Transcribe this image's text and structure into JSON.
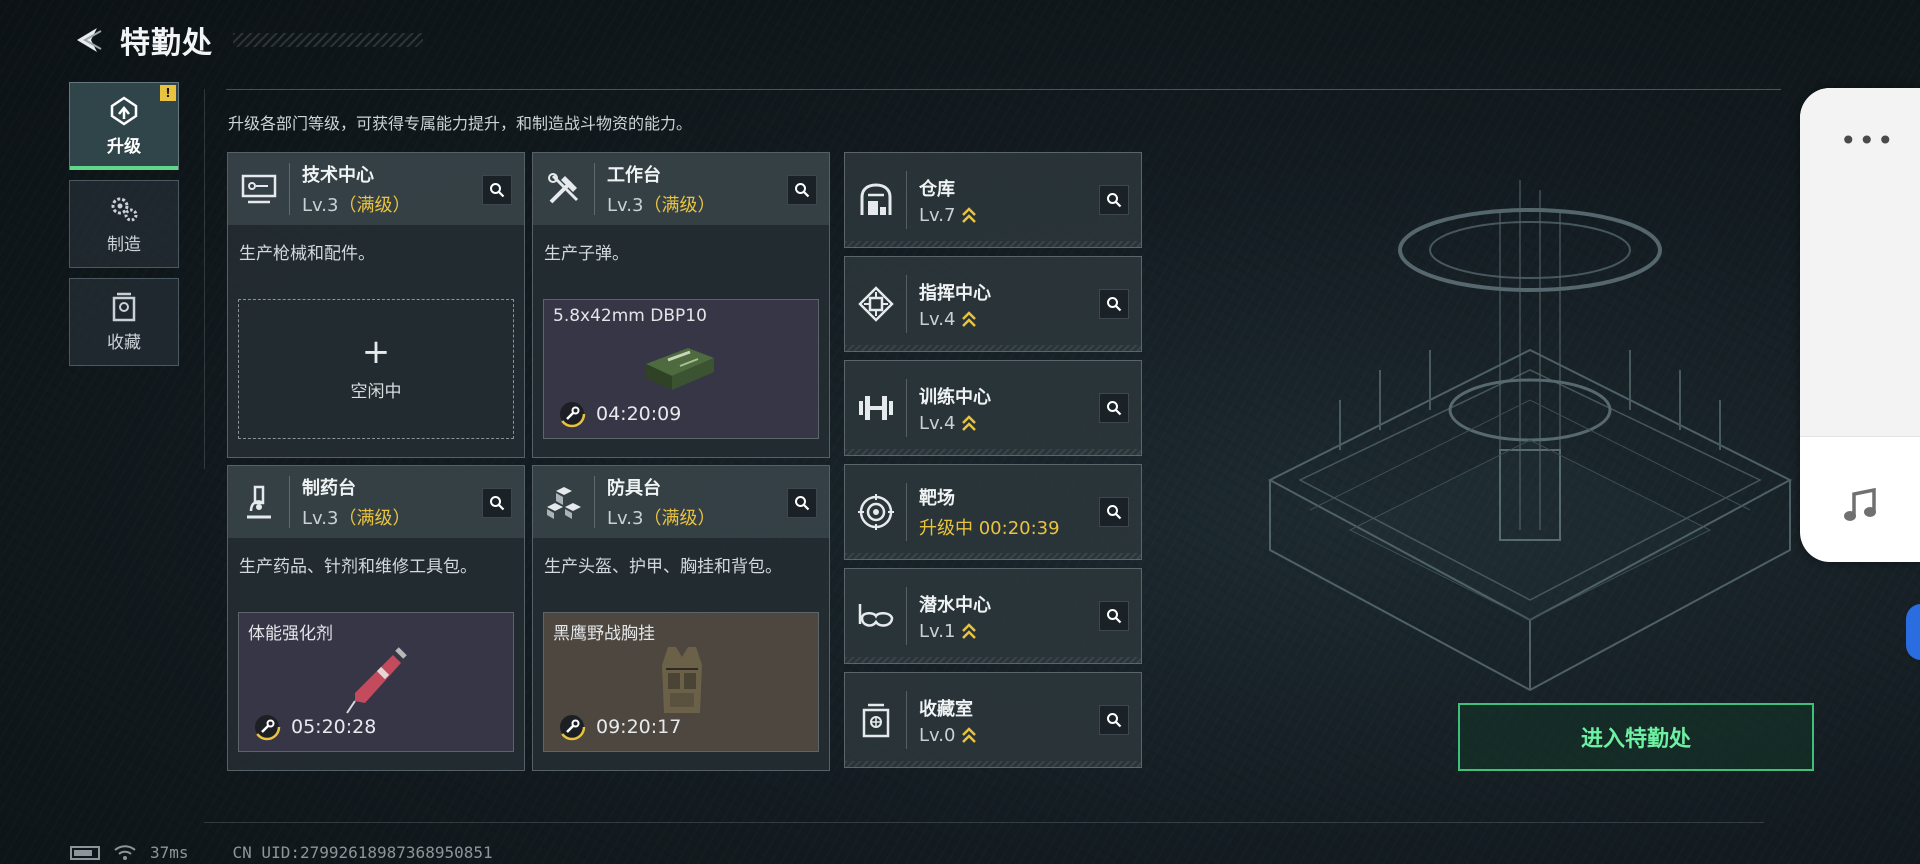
{
  "header": {
    "title": "特勤处"
  },
  "nav": {
    "items": [
      {
        "label": "升级",
        "icon": "upgrade-icon",
        "active": true,
        "badge": "!"
      },
      {
        "label": "制造",
        "icon": "gears-icon",
        "active": false
      },
      {
        "label": "收藏",
        "icon": "collection-icon",
        "active": false
      }
    ]
  },
  "description": "升级各部门等级，可获得专属能力提升，和制造战斗物资的能力。",
  "workshops": [
    {
      "name": "技术中心",
      "level": "Lv.3",
      "max": "（满级）",
      "desc": "生产枪械和配件。",
      "icon": "monitor-icon",
      "slot": {
        "state": "idle",
        "label": "空闲中"
      }
    },
    {
      "name": "工作台",
      "level": "Lv.3",
      "max": "（满级）",
      "desc": "生产子弹。",
      "icon": "tools-icon",
      "slot": {
        "state": "producing",
        "item": "5.8x42mm DBP10",
        "timer": "04:20:09",
        "bg": "purple",
        "item_icon": "ammo-box-icon"
      }
    },
    {
      "name": "制药台",
      "level": "Lv.3",
      "max": "（满级）",
      "desc": "生产药品、针剂和维修工具包。",
      "icon": "microscope-icon",
      "slot": {
        "state": "producing",
        "item": "体能强化剂",
        "timer": "05:20:28",
        "bg": "purple",
        "item_icon": "syringe-icon"
      }
    },
    {
      "name": "防具台",
      "level": "Lv.3",
      "max": "（满级）",
      "desc": "生产头盔、护甲、胸挂和背包。",
      "icon": "blocks-icon",
      "slot": {
        "state": "producing",
        "item": "黑鹰野战胸挂",
        "timer": "09:20:17",
        "bg": "brown",
        "item_icon": "vest-icon"
      }
    }
  ],
  "facilities": [
    {
      "name": "仓库",
      "level": "Lv.7",
      "icon": "warehouse-icon",
      "upgradable": true
    },
    {
      "name": "指挥中心",
      "level": "Lv.4",
      "icon": "chip-icon",
      "upgradable": true
    },
    {
      "name": "训练中心",
      "level": "Lv.4",
      "icon": "dumbbell-icon",
      "upgradable": true
    },
    {
      "name": "靶场",
      "level": "升级中 00:20:39",
      "icon": "target-icon",
      "upgradable": false,
      "upgrading": true
    },
    {
      "name": "潜水中心",
      "level": "Lv.1",
      "icon": "goggles-icon",
      "upgradable": true
    },
    {
      "name": "收藏室",
      "level": "Lv.0",
      "icon": "vault-icon",
      "upgradable": true
    }
  ],
  "enter_button": "进入特勤处",
  "float_panel": {
    "more": "•••",
    "music_icon": "music-icon"
  },
  "footer": {
    "ping": "37ms",
    "uid": "CN UID:27992618987368950851"
  },
  "colors": {
    "accent_green": "#5fd68a",
    "gold": "#e9c23f",
    "enter_border": "#3fbf7a"
  }
}
